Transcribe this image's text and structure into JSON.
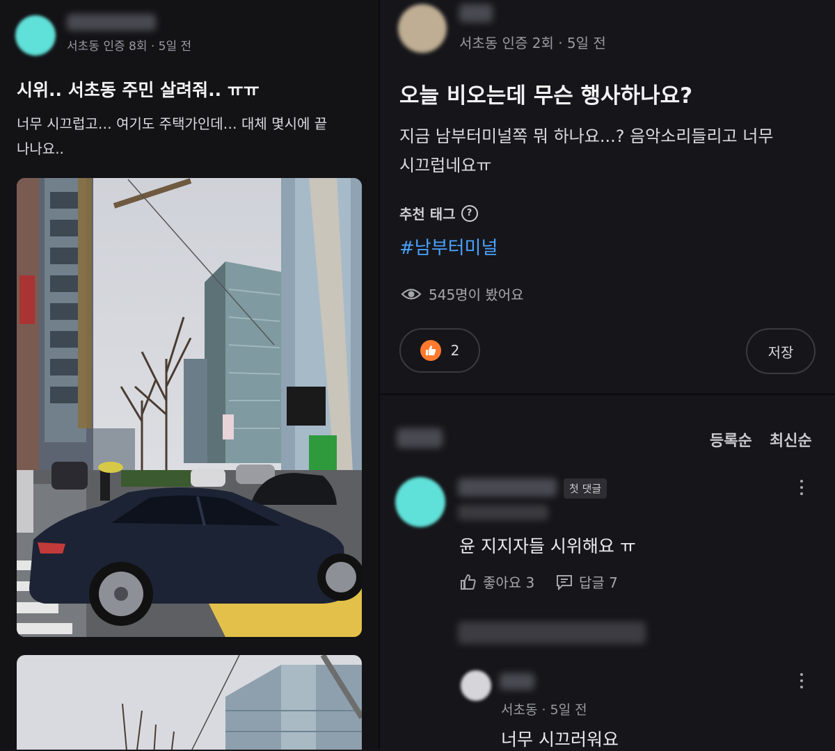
{
  "left_post": {
    "meta": "서초동 인증 8회 · 5일 전",
    "title": "시위.. 서초동 주민 살려줘.. ㅠㅠ",
    "body_line1": "너무 시끄럽고… 여기도 주택가인데… 대체 몇시에 끝",
    "body_line2": "나나요.."
  },
  "right_post": {
    "meta": "서초동 인증 2회 · 5일 전",
    "title": "오늘 비오는데 무슨 행사하나요?",
    "body_line1": "지금 남부터미널쪽 뭐 하나요...? 음악소리들리고 너무",
    "body_line2": "시끄럽네요ㅠ",
    "tag_heading": "추천 태그",
    "tag_help_glyph": "?",
    "hashtag": "#남부터미널",
    "views": "545명이 봤어요",
    "like_count": "2",
    "save_label": "저장"
  },
  "comments": {
    "sort_registered": "등록순",
    "sort_latest": "최신순",
    "first_comment_badge": "첫 댓글",
    "comment_text": "윤 지지자들 시위해요 ㅠ",
    "like_label": "좋아요 3",
    "reply_label": "답글 7",
    "reply_meta": "서초동 · 5일 전",
    "reply_text": "너무 시끄러워요"
  },
  "colors": {
    "background": "#16161a",
    "hashtag": "#4aa3ff",
    "like_accent": "#ff7a2e",
    "avatar_teal": "#5fe0d8"
  },
  "icons": [
    "eye-icon",
    "thumbs-up-icon",
    "reply-icon",
    "more-vertical-icon",
    "help-circle-icon"
  ]
}
